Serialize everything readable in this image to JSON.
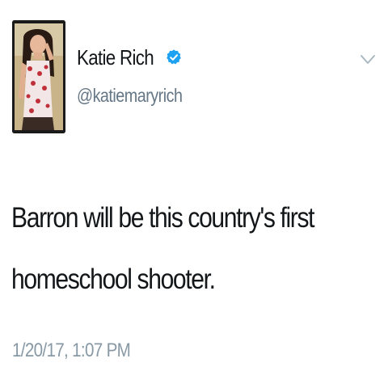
{
  "tweet": {
    "author": {
      "display_name": "Katie Rich",
      "handle": "@katiemaryrich",
      "verified": true,
      "verified_color": "#1da1f2",
      "avatar_icon": "profile-photo"
    },
    "menu_icon": "chevron-down-icon",
    "text": "Barron will be this country's first\nhomeschool shooter.",
    "timestamp": "1/20/17, 1:07 PM"
  }
}
